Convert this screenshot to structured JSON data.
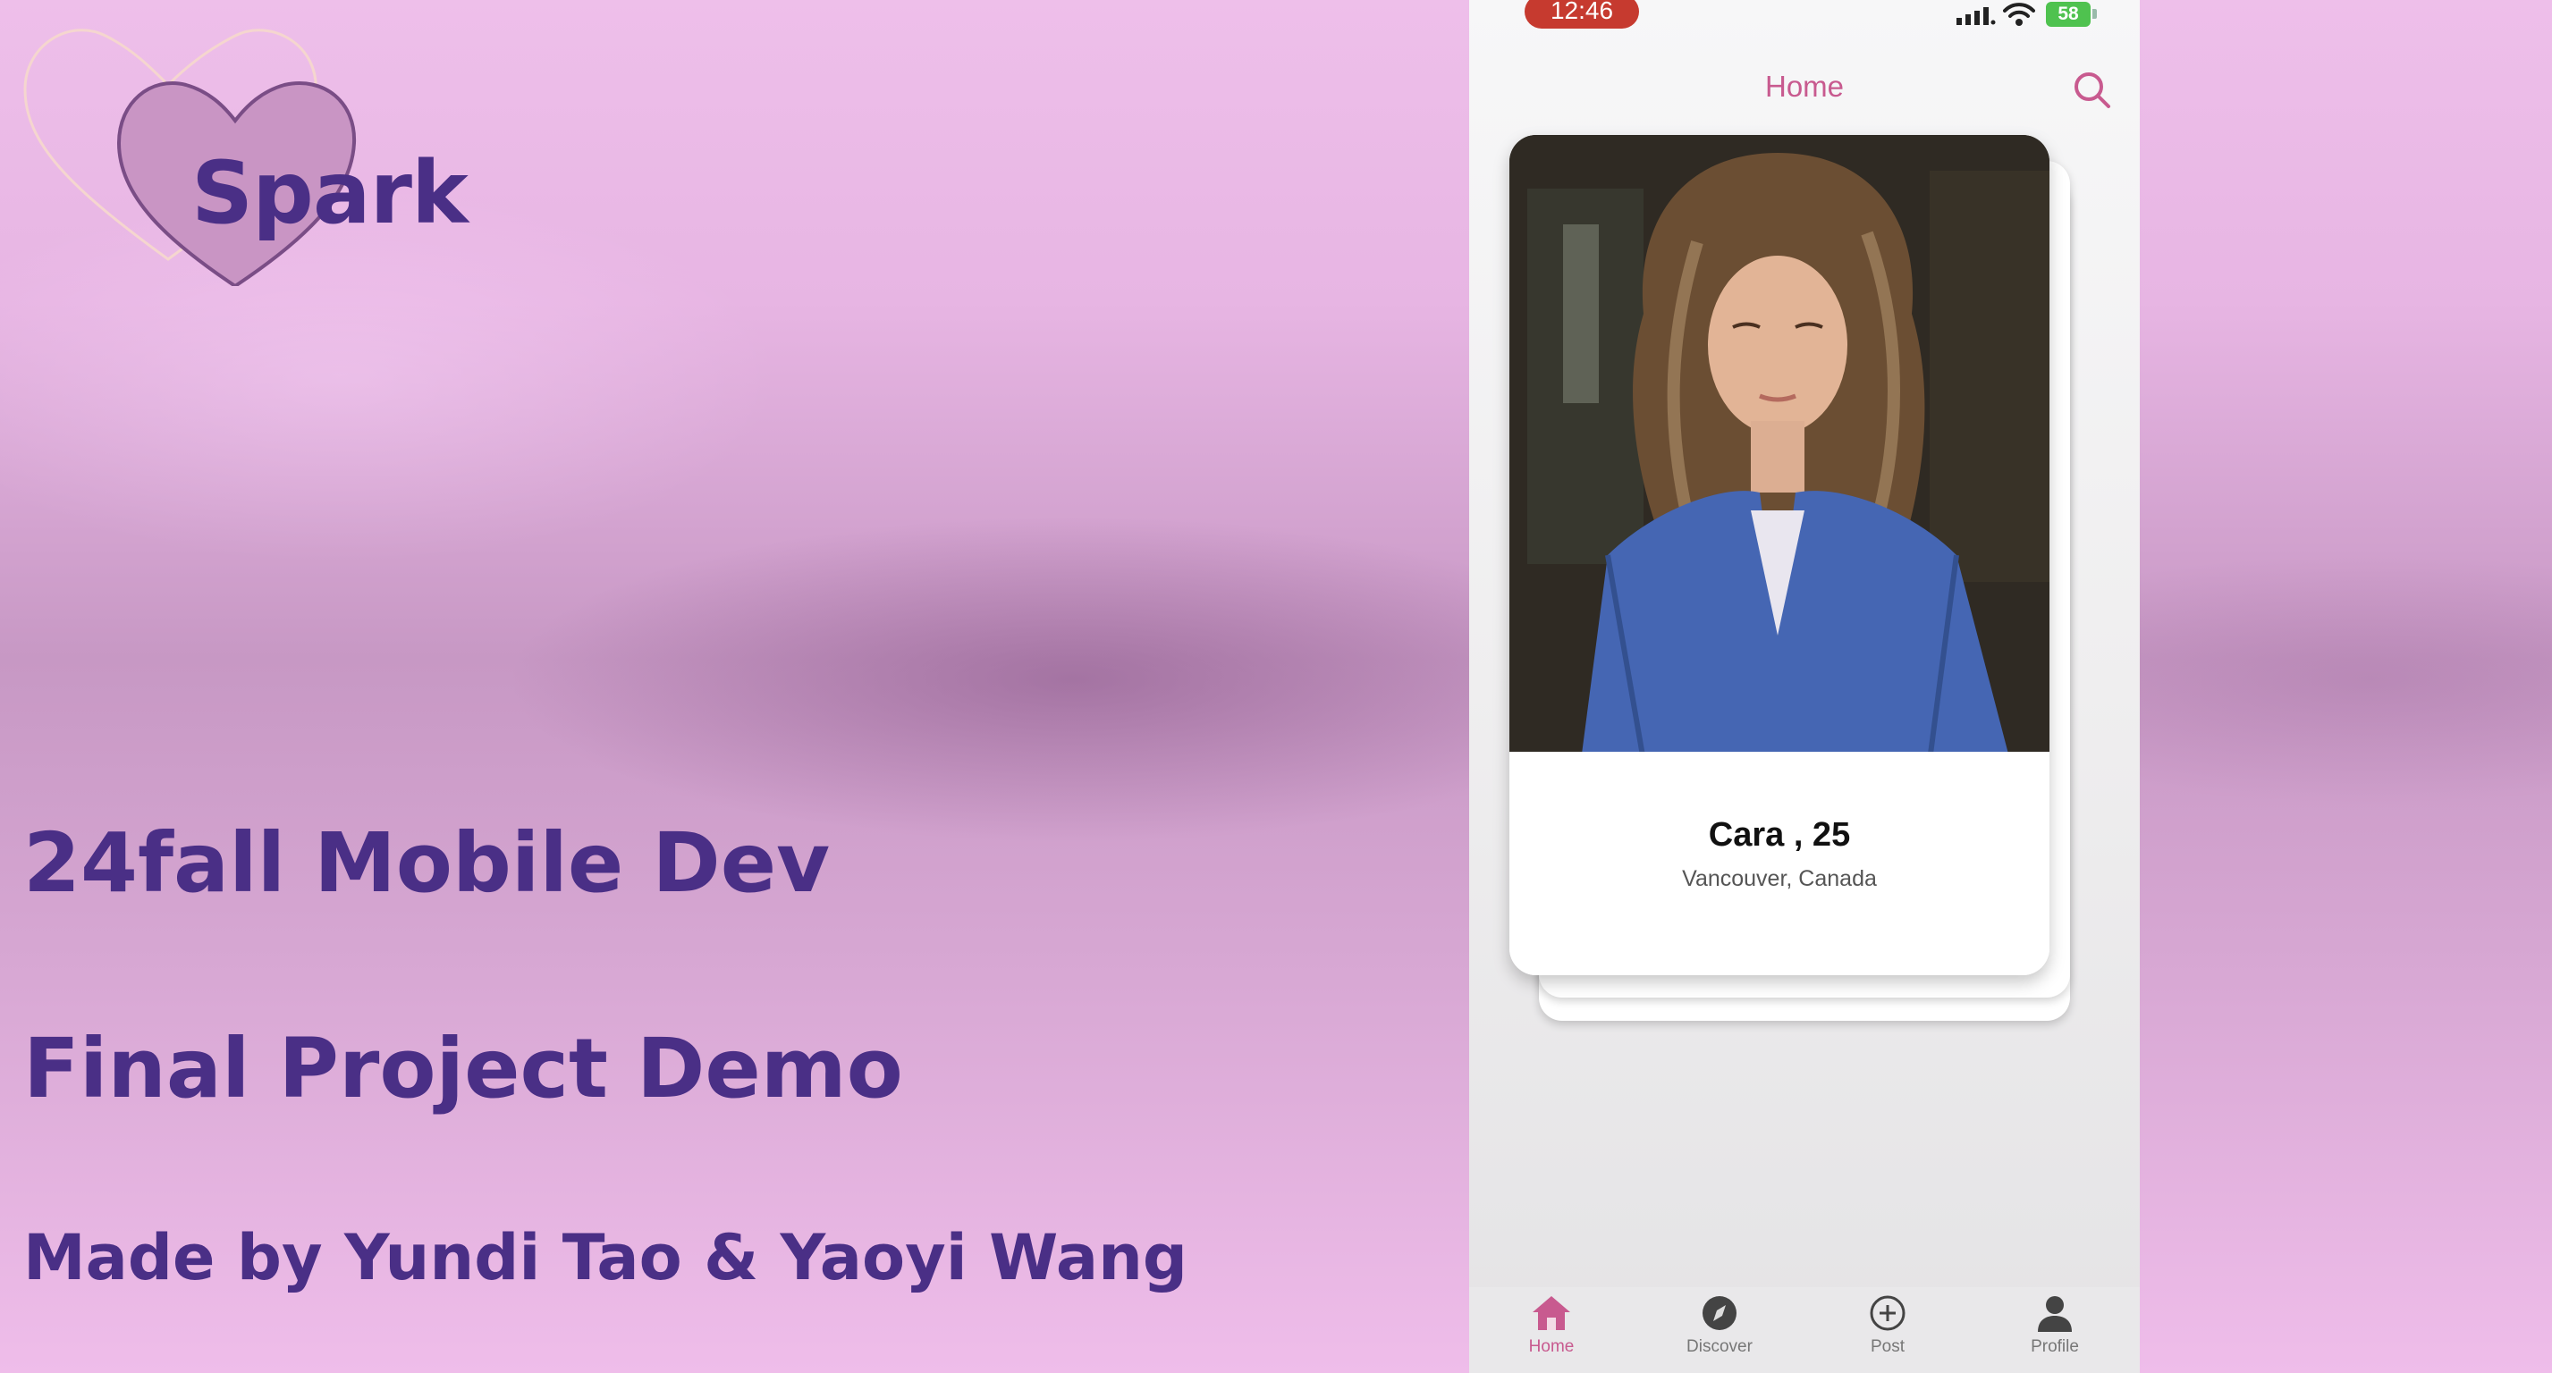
{
  "slide": {
    "logo_text": "Spark",
    "headline_1": "24fall Mobile Dev",
    "headline_2": "Final Project Demo",
    "credits": "Made by Yundi Tao & Yaoyi Wang"
  },
  "status_bar": {
    "time": "12:46",
    "battery": "58"
  },
  "nav": {
    "title": "Home"
  },
  "card": {
    "name": "Cara , 25",
    "location": "Vancouver, Canada"
  },
  "tabs": [
    {
      "label": "Home",
      "icon": "home-icon",
      "active": true
    },
    {
      "label": "Discover",
      "icon": "compass-icon",
      "active": false
    },
    {
      "label": "Post",
      "icon": "plus-circle-icon",
      "active": false
    },
    {
      "label": "Profile",
      "icon": "person-icon",
      "active": false
    }
  ],
  "colors": {
    "accent_pink": "#c85a8f",
    "slide_text_purple": "#4a2f86",
    "time_pill_red": "#c63a2f",
    "battery_green": "#4fc24f"
  }
}
